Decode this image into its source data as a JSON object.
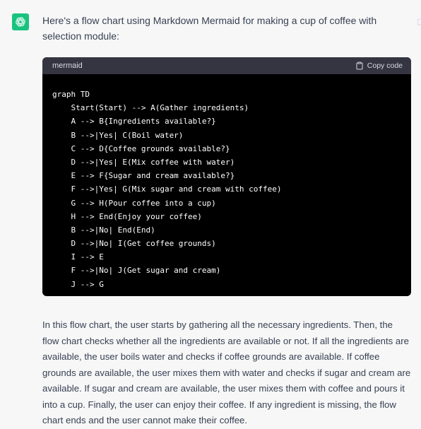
{
  "assistant": {
    "avatar_icon": "openai-logo-icon",
    "avatar_color": "#19c37d"
  },
  "message": {
    "intro": "Here's a flow chart using Markdown Mermaid for making a cup of coffee with selection module:",
    "code_block": {
      "language": "mermaid",
      "copy_label": "Copy code",
      "lines": [
        "graph TD",
        "    Start(Start) --> A(Gather ingredients)",
        "    A --> B{Ingredients available?}",
        "    B -->|Yes| C(Boil water)",
        "    C --> D{Coffee grounds available?}",
        "    D -->|Yes| E(Mix coffee with water)",
        "    E --> F{Sugar and cream available?}",
        "    F -->|Yes| G(Mix sugar and cream with coffee)",
        "    G --> H(Pour coffee into a cup)",
        "    H --> End(Enjoy your coffee)",
        "    B -->|No| End(End)",
        "    D -->|No| I(Get coffee grounds)",
        "    I --> E",
        "    F -->|No| J(Get sugar and cream)",
        "    J --> G"
      ]
    },
    "explanation": "In this flow chart, the user starts by gathering all the necessary ingredients. Then, the flow chart checks whether all the ingredients are available or not. If all the ingredients are available, the user boils water and checks if coffee grounds are available. If coffee grounds are available, the user mixes them with water and checks if sugar and cream are available. If sugar and cream are available, the user mixes them with coffee and pours it into a cup. Finally, the user can enjoy their coffee. If any ingredient is missing, the flow chart ends and the user cannot make their coffee."
  }
}
